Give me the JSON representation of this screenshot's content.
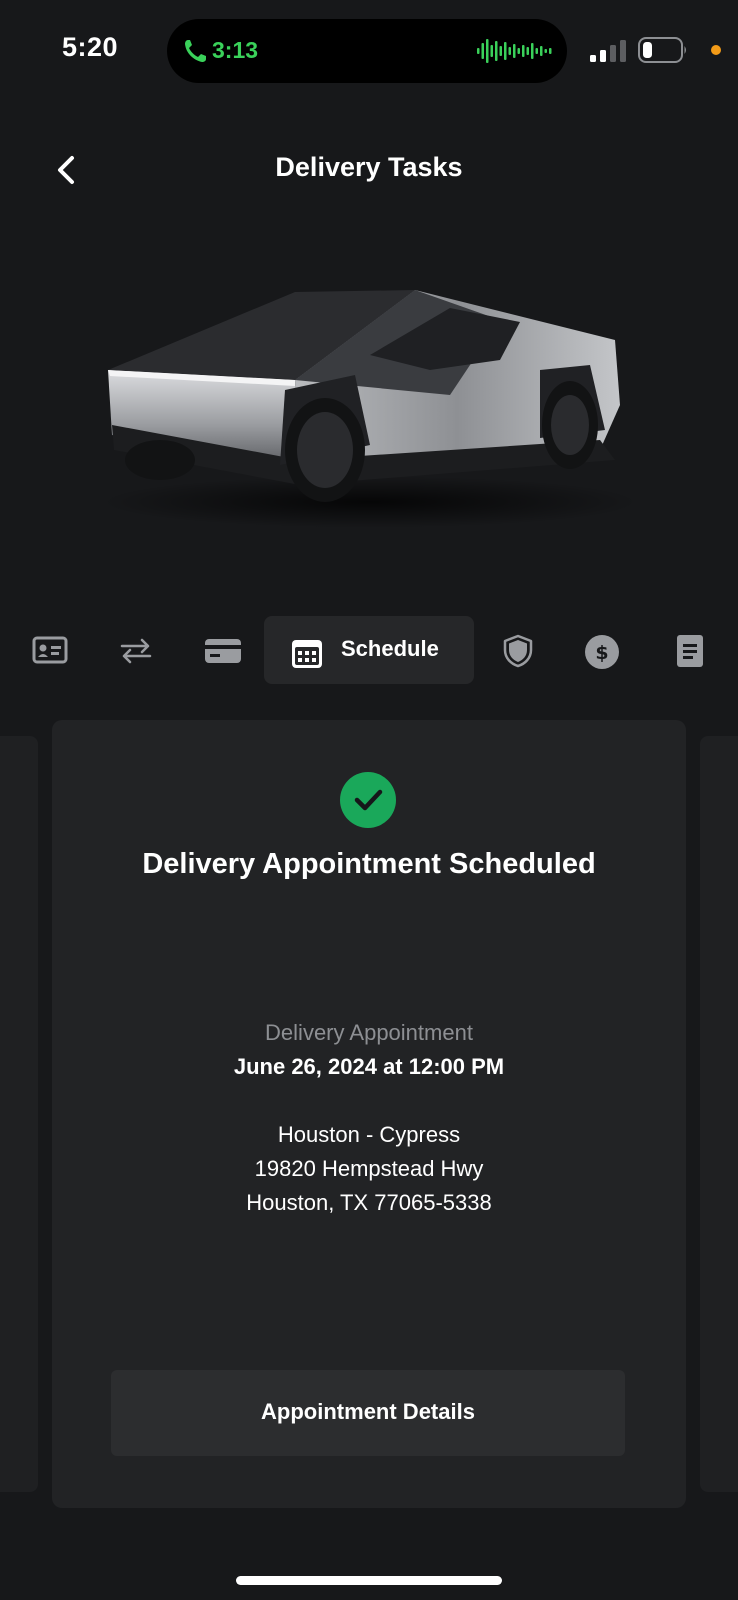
{
  "status_bar": {
    "time": "5:20",
    "call_duration": "3:13",
    "accent_color": "#3ad15a"
  },
  "nav": {
    "title": "Delivery Tasks",
    "back_icon": "chevron-left-icon"
  },
  "tabs": [
    {
      "icon": "id-card-icon",
      "active": false
    },
    {
      "icon": "transfer-arrows-icon",
      "active": false
    },
    {
      "icon": "credit-card-icon",
      "active": false
    },
    {
      "icon": "calendar-icon",
      "label": "Schedule",
      "active": true
    },
    {
      "icon": "shield-icon",
      "active": false
    },
    {
      "icon": "dollar-icon",
      "active": false
    },
    {
      "icon": "document-icon",
      "active": false
    }
  ],
  "card": {
    "status_icon": "check-circle-icon",
    "status_color": "#1aa85a",
    "heading": "Delivery Appointment Scheduled",
    "appointment_label": "Delivery Appointment",
    "appointment_datetime": "June 26, 2024 at 12:00 PM",
    "location_name": "Houston - Cypress",
    "address_line1": "19820 Hempstead Hwy",
    "address_line2": "Houston, TX 77065-5338",
    "button_label": "Appointment Details"
  }
}
